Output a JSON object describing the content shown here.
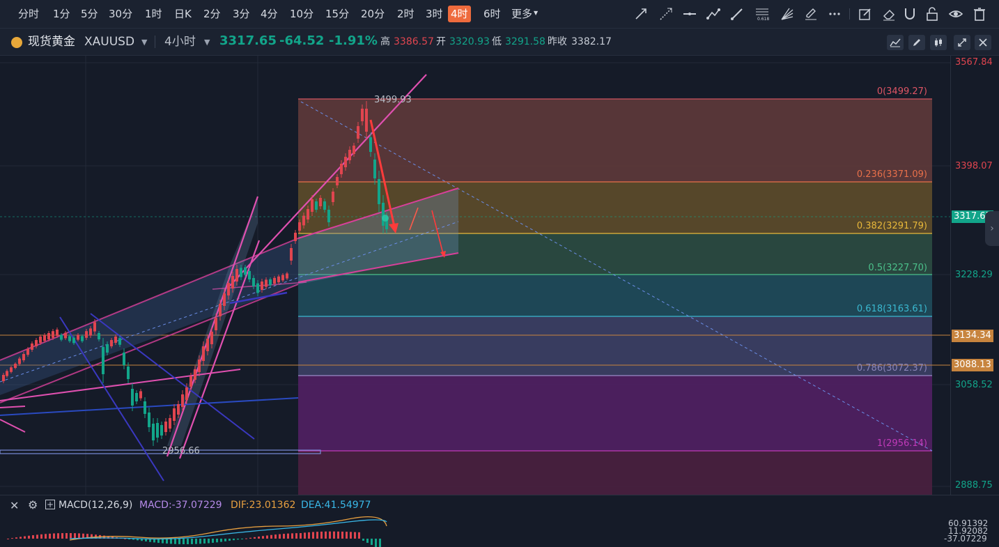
{
  "timeframes": [
    {
      "label": "分时",
      "active": false
    },
    {
      "label": "1分",
      "active": false
    },
    {
      "label": "5分",
      "active": false
    },
    {
      "label": "30分",
      "active": false
    },
    {
      "label": "1时",
      "active": false
    },
    {
      "label": "日K",
      "active": false
    },
    {
      "label": "2分",
      "active": false
    },
    {
      "label": "3分",
      "active": false
    },
    {
      "label": "4分",
      "active": false
    },
    {
      "label": "10分",
      "active": false
    },
    {
      "label": "15分",
      "active": false
    },
    {
      "label": "20分",
      "active": false
    },
    {
      "label": "2时",
      "active": false
    },
    {
      "label": "3时",
      "active": false
    },
    {
      "label": "4时",
      "active": true
    },
    {
      "label": "6时",
      "active": false
    },
    {
      "label": "更多",
      "active": false
    }
  ],
  "drawing_tools": [
    "trend-line-icon",
    "extended-line-icon",
    "horizontal-line-icon",
    "polyline-icon",
    "parallel-channel-icon",
    "fibonacci-icon",
    "gann-fan-icon",
    "pen-icon",
    "more-dots-icon",
    "edit-icon",
    "eraser-icon",
    "magnet-icon",
    "lock-icon",
    "eye-icon",
    "trash-icon"
  ],
  "symbol": {
    "name": "现货黄金",
    "code": "XAUUSD",
    "period": "4小时"
  },
  "quote": {
    "price": "3317.65",
    "change": "-64.52",
    "change_pct": "-1.91%",
    "high_label": "高",
    "high": "3386.57",
    "open_label": "开",
    "open": "3320.93",
    "low_label": "低",
    "low": "3291.58",
    "prev_label": "昨收",
    "prev": "3382.17"
  },
  "colors": {
    "up": "#e0454f",
    "down": "#12a58a",
    "accent": "#ee6b3d",
    "bg": "#151b28"
  },
  "y_axis": {
    "labels": [
      {
        "text": "3567.84",
        "color": "#e0454f"
      },
      {
        "text": "3398.07",
        "color": "#e0454f"
      },
      {
        "text": "3228.29",
        "color": "#12a58a"
      },
      {
        "text": "3058.52",
        "color": "#12a58a"
      },
      {
        "text": "2888.75",
        "color": "#12a58a"
      }
    ],
    "tags": [
      {
        "text": "3317.65",
        "bg": "#12a58a"
      },
      {
        "text": "3134.34",
        "bg": "#c7843e"
      },
      {
        "text": "3088.13",
        "bg": "#c7843e"
      }
    ]
  },
  "fib_levels": [
    {
      "label": "0(3499.27)",
      "color": "#e05565"
    },
    {
      "label": "0.236(3371.09)",
      "color": "#e8704a"
    },
    {
      "label": "0.382(3291.79)",
      "color": "#e8b83a"
    },
    {
      "label": "0.5(3227.70)",
      "color": "#4bc08a"
    },
    {
      "label": "0.618(3163.61)",
      "color": "#3ab8d0"
    },
    {
      "label": "0.786(3072.37)",
      "color": "#8a84b8"
    },
    {
      "label": "1(2956.14)",
      "color": "#c03ab8"
    }
  ],
  "annotations": {
    "high_mark": "3499.93",
    "low_mark": "2956.66"
  },
  "macd": {
    "name": "MACD(12,26,9)",
    "macd": "MACD:-37.07229",
    "dif": "DIF:23.01362",
    "dea": "DEA:41.54977",
    "scale": [
      "60.91392",
      "11.92082",
      "-37.07229"
    ]
  }
}
